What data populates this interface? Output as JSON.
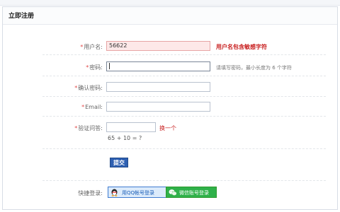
{
  "header": {
    "title": "立即注册"
  },
  "form": {
    "username": {
      "label": "用户名:",
      "value": "56622",
      "error": "用户名包含敏感字符"
    },
    "password": {
      "label": "密码:",
      "hint": "请填写密码，最小长度为 6 个字符"
    },
    "confirm_password": {
      "label": "确认密码:"
    },
    "email": {
      "label": "Email:"
    },
    "captcha": {
      "label": "验证问答:",
      "refresh_link": "换一个",
      "question": "65 + 10 = ?"
    },
    "submit_label": "提交"
  },
  "quick_login": {
    "label": "快捷登录:",
    "qq_label": "用QQ帐号登录",
    "wechat_label": "微信账号登录"
  },
  "colors": {
    "accent_blue": "#2e60b2",
    "error_red": "#c81f1f",
    "wechat_green": "#2fb14a"
  }
}
